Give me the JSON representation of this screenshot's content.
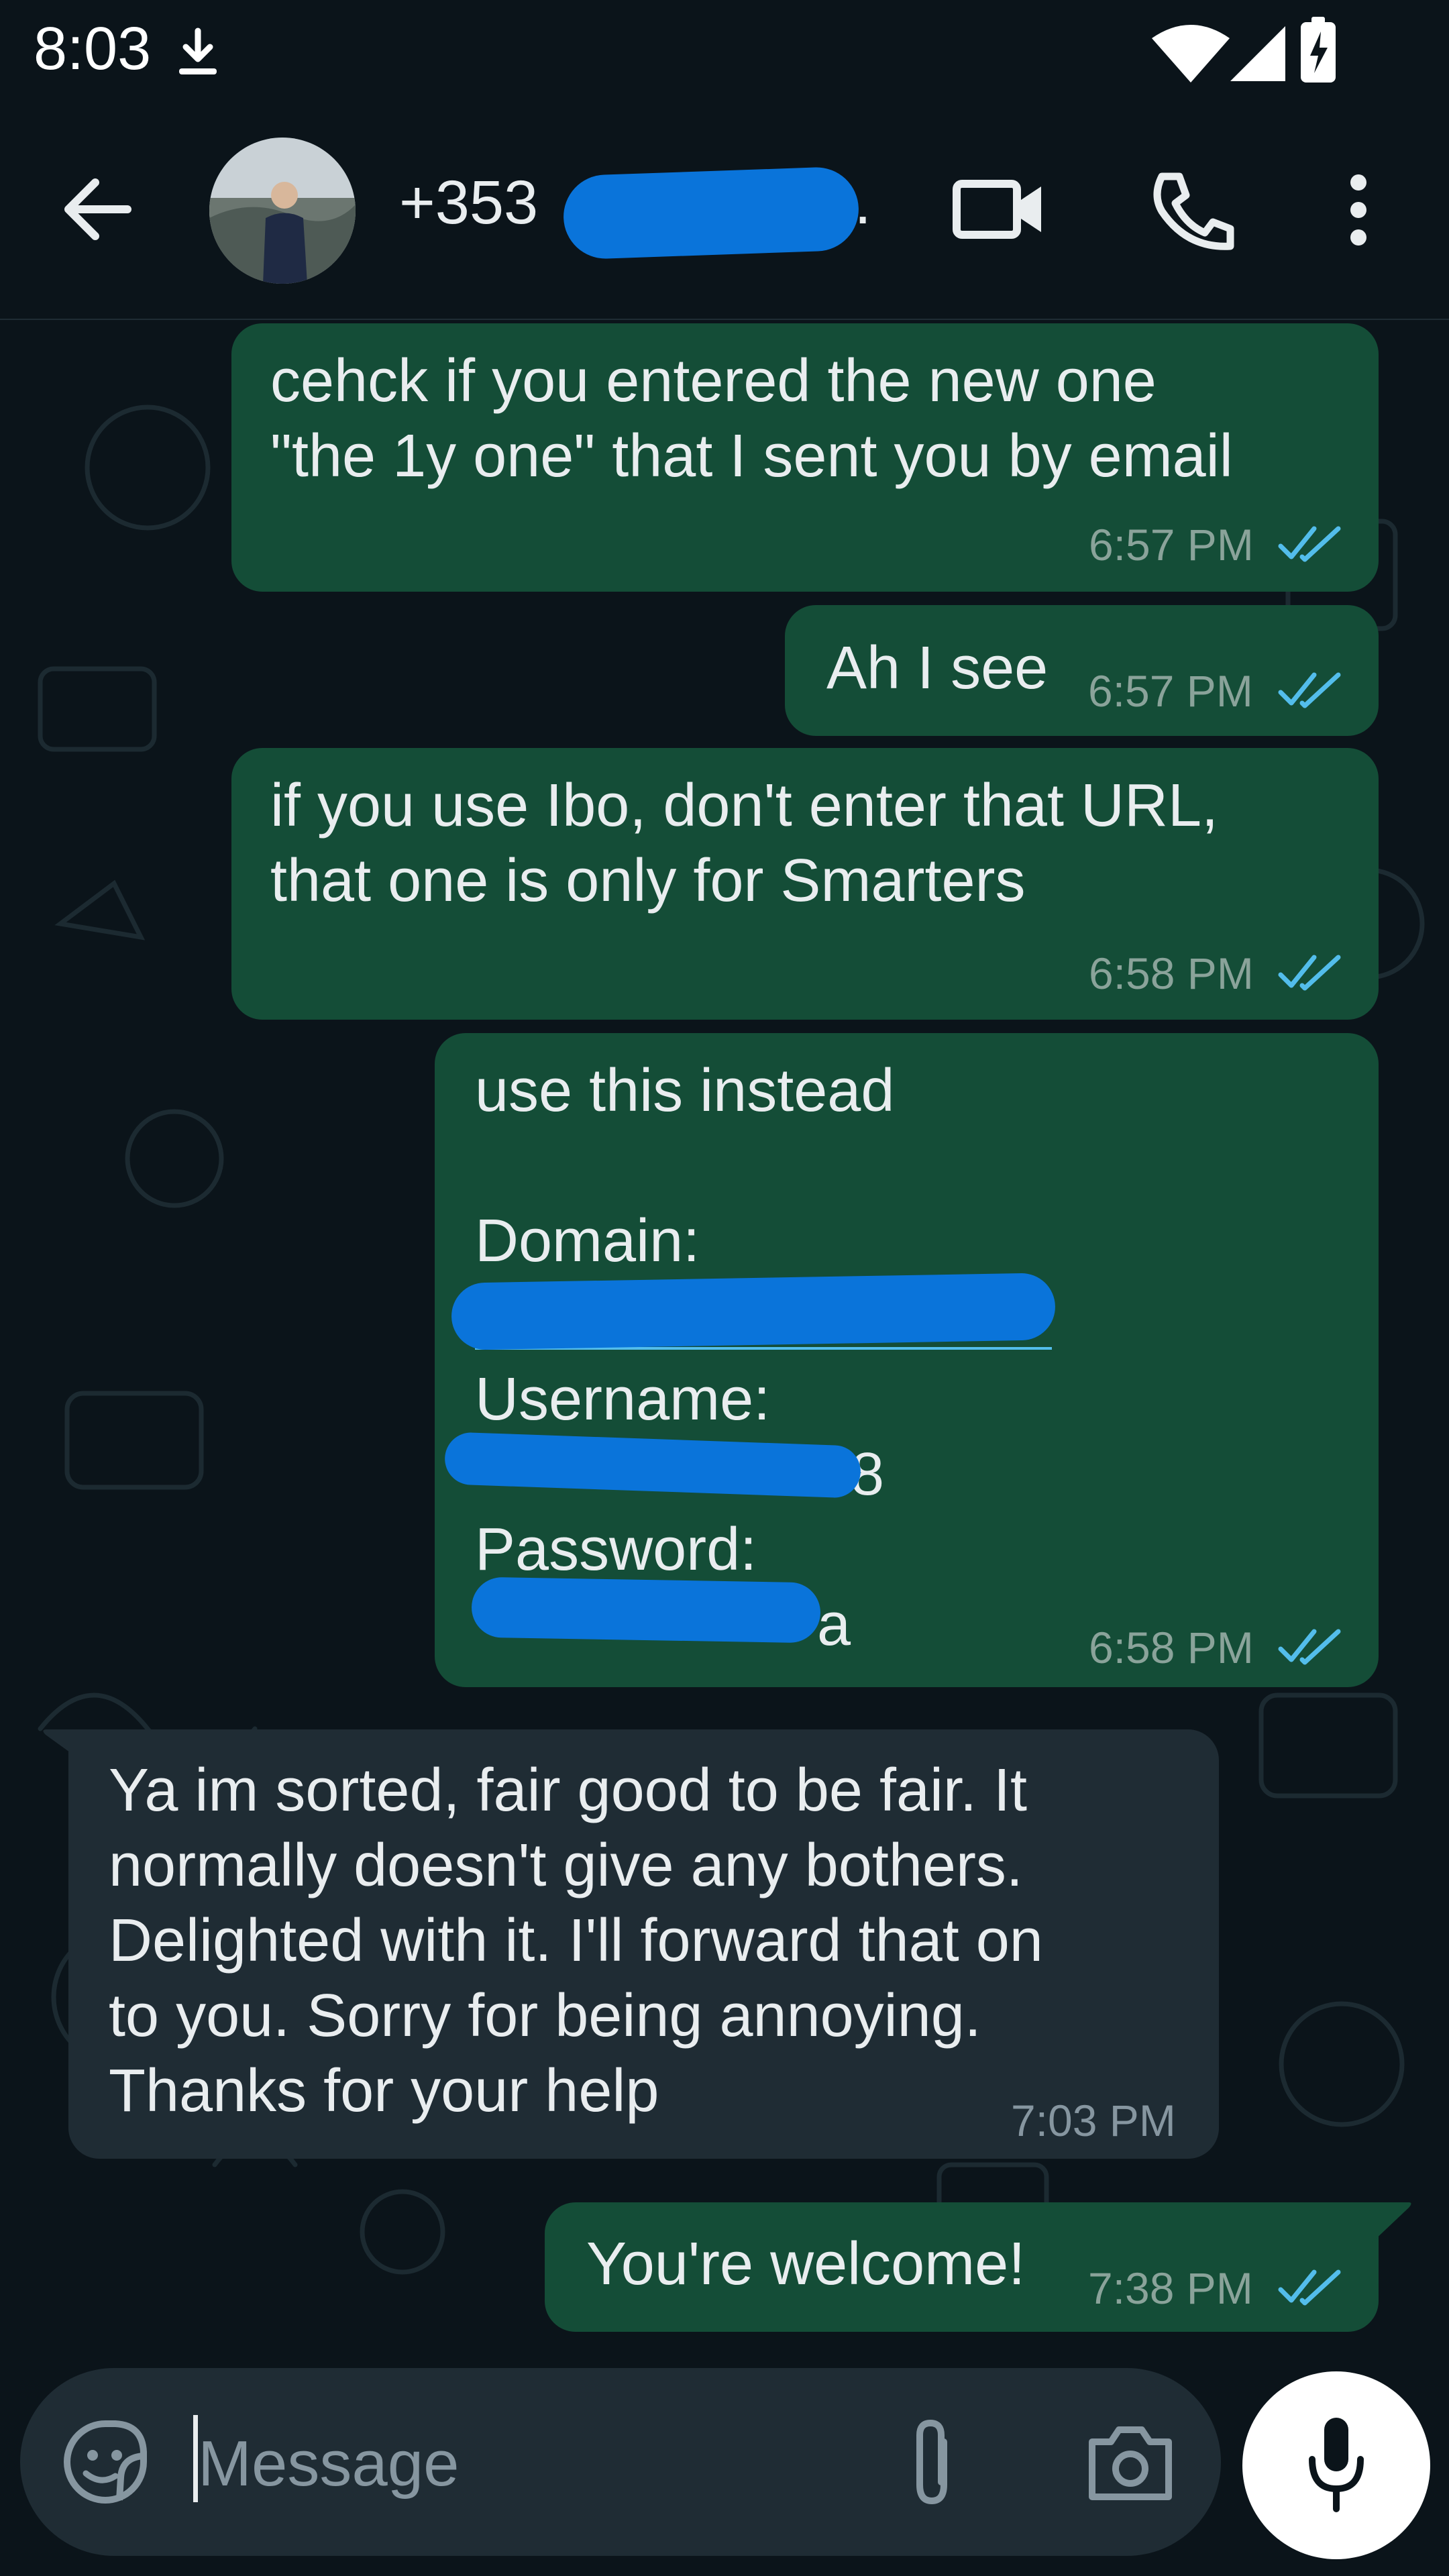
{
  "status_bar": {
    "time": "8:03"
  },
  "header": {
    "contact_visible": "+353",
    "contact_suffix": "..."
  },
  "messages": [
    {
      "text": "cehck if you entered the new one\n\"the 1y one\" that I sent you by email",
      "time": "6:57 PM"
    },
    {
      "text": "Ah I see",
      "time": "6:57 PM"
    },
    {
      "text": "if you use Ibo, don't enter that URL,\nthat one is only for Smarters",
      "time": "6:58 PM"
    },
    {
      "text": "use this instead\n\nDomain:",
      "label_username": "Username:",
      "label_password": "Password:",
      "username_visible_tail": "8",
      "password_visible_tail": "a",
      "time": "6:58 PM"
    },
    {
      "text": "Ya im sorted, fair good to be fair. It\nnormally doesn't give any bothers.\nDelighted with it. I'll forward that on\nto you. Sorry for being annoying.\nThanks for your help",
      "time": "7:03 PM"
    },
    {
      "text": "You're welcome!",
      "time": "7:38 PM"
    }
  ],
  "input": {
    "placeholder": "Message"
  },
  "colors": {
    "background": "#0b141a",
    "outgoing_bubble": "#144d37",
    "incoming_bubble": "#1f2c34",
    "read_ticks": "#53bdeb",
    "redaction": "#0a74da"
  }
}
